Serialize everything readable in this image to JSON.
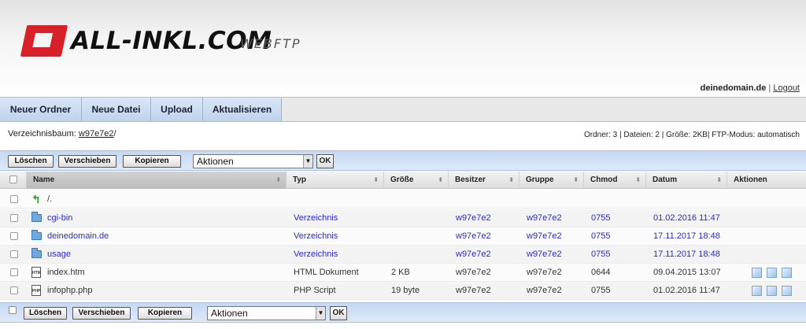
{
  "header": {
    "logo_text": "ALL-INKL.COM",
    "logo_sub": "WEBFTP",
    "domain": "deinedomain.de",
    "separator": "|",
    "logout": "Logout"
  },
  "nav": {
    "tabs": [
      {
        "label": "Neuer Ordner"
      },
      {
        "label": "Neue Datei"
      },
      {
        "label": "Upload"
      },
      {
        "label": "Aktualisieren"
      }
    ]
  },
  "path": {
    "label": "Verzeichnisbaum:",
    "dir": "w97e7e2",
    "slash": "/",
    "stats": "Ordner: 3 | Dateien: 2 | Größe: 2KB| FTP-Modus: automatisch"
  },
  "actions": {
    "delete": "Löschen",
    "move": "Verschieben",
    "copy": "Kopieren",
    "select_value": "Aktionen",
    "ok": "OK"
  },
  "table": {
    "columns": [
      "Name",
      "Typ",
      "Größe",
      "Besitzer",
      "Gruppe",
      "Chmod",
      "Datum",
      "Aktionen"
    ],
    "up_row": "/.",
    "rows": [
      {
        "name": "cgi-bin",
        "type": "Verzeichnis",
        "size": "",
        "owner": "w97e7e2",
        "group": "w97e7e2",
        "chmod": "0755",
        "date": "01.02.2016 11:47",
        "kind": "folder",
        "icon_label": ""
      },
      {
        "name": "deinedomain.de",
        "type": "Verzeichnis",
        "size": "",
        "owner": "w97e7e2",
        "group": "w97e7e2",
        "chmod": "0755",
        "date": "17.11.2017 18:48",
        "kind": "folder",
        "icon_label": ""
      },
      {
        "name": "usage",
        "type": "Verzeichnis",
        "size": "",
        "owner": "w97e7e2",
        "group": "w97e7e2",
        "chmod": "0755",
        "date": "17.11.2017 18:48",
        "kind": "folder",
        "icon_label": ""
      },
      {
        "name": "index.htm",
        "type": "HTML Dokument",
        "size": "2 KB",
        "owner": "w97e7e2",
        "group": "w97e7e2",
        "chmod": "0644",
        "date": "09.04.2015 13:07",
        "kind": "file",
        "icon_label": "HTM"
      },
      {
        "name": "infophp.php",
        "type": "PHP Script",
        "size": "19 byte",
        "owner": "w97e7e2",
        "group": "w97e7e2",
        "chmod": "0755",
        "date": "01.02.2016 11:47",
        "kind": "file",
        "icon_label": "PHP"
      }
    ]
  },
  "icons": {
    "folder": "folder-icon",
    "file": "file-icon",
    "up": "folder-up-icon",
    "edit": "edit-icon",
    "view": "view-icon",
    "rename": "rename-icon"
  }
}
